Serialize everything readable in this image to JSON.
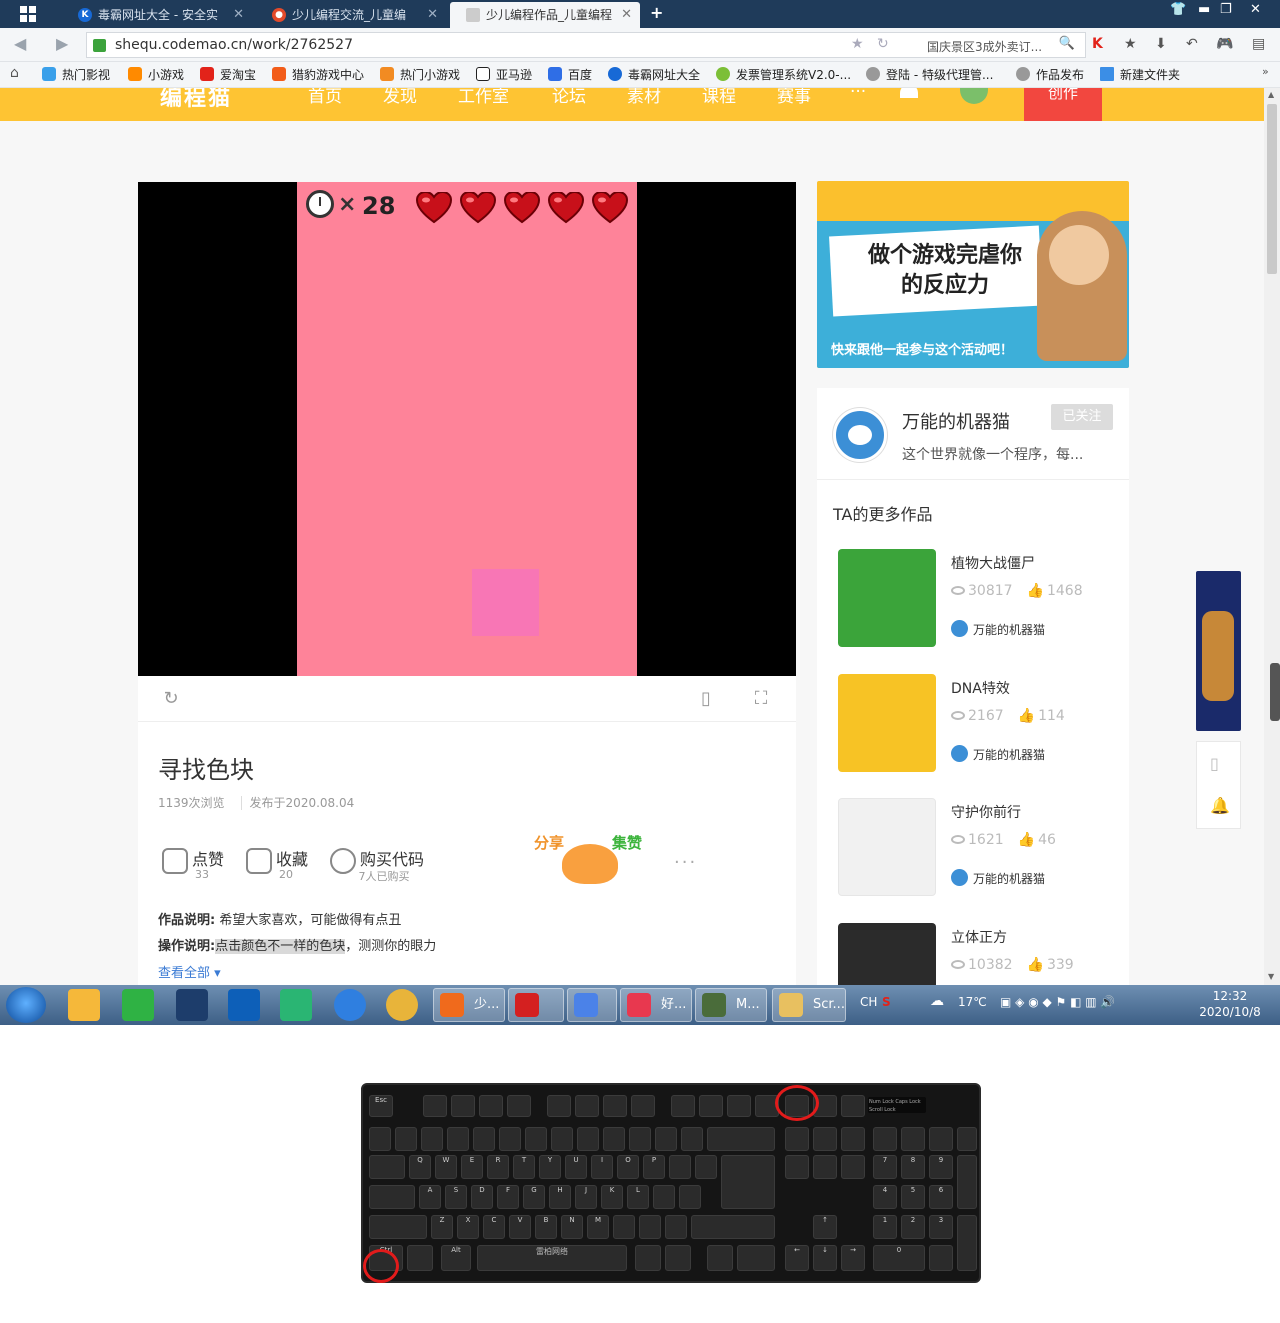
{
  "browser": {
    "tabs": [
      {
        "label": "毒霸网址大全 - 安全实",
        "active": false,
        "icon": "k-logo-icon"
      },
      {
        "label": "少儿编程交流_儿童编",
        "active": false,
        "icon": "codemao-logo-icon"
      },
      {
        "label": "少儿编程作品_儿童编程",
        "active": true,
        "icon": "page-icon"
      }
    ],
    "url": "shequ.codemao.cn/work/2762527",
    "search_text": "国庆景区3成外卖订...",
    "bookmarks": [
      {
        "label": "热门影视",
        "color": "#3aa0ea"
      },
      {
        "label": "小游戏",
        "color": "#ff8a00"
      },
      {
        "label": "爱淘宝",
        "color": "#e2231a"
      },
      {
        "label": "猎豹游戏中心",
        "color": "#f25c19"
      },
      {
        "label": "热门小游戏",
        "color": "#f28b22"
      },
      {
        "label": "亚马逊",
        "color": "#222222"
      },
      {
        "label": "百度",
        "color": "#2f6ee6"
      },
      {
        "label": "毒霸网址大全",
        "color": "#1769d6"
      },
      {
        "label": "发票管理系统V2.0-...",
        "color": "#7cbf37"
      },
      {
        "label": "登陆 - 特级代理管...",
        "color": "#888888"
      },
      {
        "label": "作品发布",
        "color": "#888888"
      },
      {
        "label": "新建文件夹",
        "color": "#3b8ee6"
      }
    ]
  },
  "site": {
    "logo": "编程猫",
    "nav": [
      "首页",
      "发现",
      "工作室",
      "论坛",
      "素材",
      "课程",
      "赛事",
      "···"
    ],
    "create_label": "创作",
    "accent": "#fec433"
  },
  "game": {
    "timer_x": "×",
    "timer_value": "28",
    "hearts": 5,
    "bg_color": "#fe8399",
    "target_color": "#f876b5"
  },
  "work": {
    "title": "寻找色块",
    "views": "1139次浏览",
    "published": "发布于2020.08.04",
    "actions": [
      {
        "label": "点赞",
        "count": "33",
        "icon": "like-icon"
      },
      {
        "label": "收藏",
        "count": "20",
        "icon": "favorite-icon"
      },
      {
        "label": "购买代码",
        "count": "7人已购买",
        "icon": "buy-code-icon"
      }
    ],
    "share_left": "分享",
    "share_right": "集赞",
    "more": "···",
    "desc_label": "作品说明:",
    "desc_text": "希望大家喜欢，可能做得有点丑",
    "op_label": "操作说明:",
    "op_highlight": "点击颜色不一样的色块",
    "op_text": "，测测你的眼力",
    "see_all": "查看全部 ▾"
  },
  "banner": {
    "headline_1": "做个游戏完虐你",
    "headline_2": "的反应力",
    "caption": "快来跟他一起参与这个活动吧！"
  },
  "author": {
    "name": "万能的机器猫",
    "bio": "这个世界就像一个程序，每...",
    "follow_label": "已关注",
    "more_title": "TA的更多作品",
    "works": [
      {
        "name": "植物大战僵尸",
        "views": "30817",
        "likes": "1468",
        "author": "万能的机器猫",
        "color": "#3ba43a"
      },
      {
        "name": "DNA特效",
        "views": "2167",
        "likes": "114",
        "author": "万能的机器猫",
        "color": "#f7c325"
      },
      {
        "name": "守护你前行",
        "views": "1621",
        "likes": "46",
        "author": "万能的机器猫",
        "color": "#f1f1f1"
      },
      {
        "name": "立体正方",
        "views": "10382",
        "likes": "339",
        "author": "万能的机器猫",
        "color": "#2b2b2b"
      }
    ]
  },
  "taskbar": {
    "tasks": [
      {
        "label": "少...",
        "color": "#f06a1c"
      },
      {
        "label": "",
        "color": "#d42020"
      },
      {
        "label": "",
        "color": "#4b82e8"
      },
      {
        "label": "好...",
        "color": "#e8384f"
      },
      {
        "label": "M...",
        "color": "#4a6c3a"
      },
      {
        "label": "Scr...",
        "color": "#e8c060"
      }
    ],
    "lang": "CH",
    "weather": "17℃",
    "time": "12:32",
    "date": "2020/10/8"
  },
  "keyboard": {
    "brand": "雷柏网络",
    "leds": [
      "Num Lock",
      "Caps Lock",
      "Scroll Lock"
    ]
  }
}
